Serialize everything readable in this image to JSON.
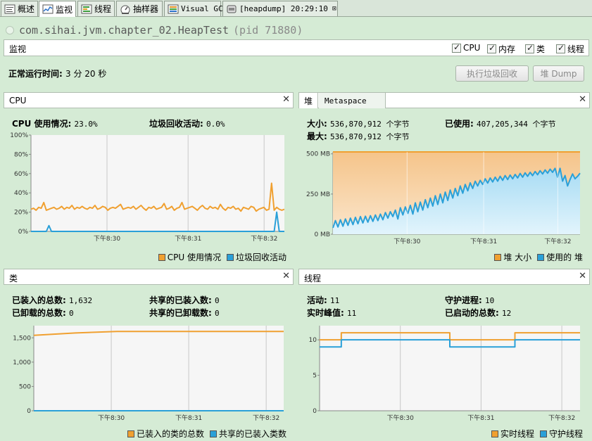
{
  "tabs": [
    {
      "label": "概述",
      "icon": "overview-icon"
    },
    {
      "label": "监视",
      "icon": "monitor-icon"
    },
    {
      "label": "线程",
      "icon": "threads-icon"
    },
    {
      "label": "抽样器",
      "icon": "sampler-icon"
    },
    {
      "label": "Visual GC",
      "icon": "visual-gc-icon"
    },
    {
      "label": "[heapdump] 20:29:10",
      "icon": "heapdump-icon"
    }
  ],
  "header": {
    "title": "com.sihai.jvm.chapter_02.HeapTest",
    "pid": "(pid 71880)"
  },
  "section": {
    "title": "监视",
    "checks": [
      {
        "label": "CPU",
        "checked": true
      },
      {
        "label": "内存",
        "checked": true
      },
      {
        "label": "类",
        "checked": true
      },
      {
        "label": "线程",
        "checked": true
      }
    ]
  },
  "uptime": {
    "label": "正常运行时间:",
    "value": "3 分 20 秒"
  },
  "buttons": {
    "gc": "执行垃圾回收",
    "heap_dump": "堆 Dump"
  },
  "colors": {
    "orange": "#f0a030",
    "blue": "#2aa0d8"
  },
  "cpu": {
    "title": "CPU",
    "usage_label": "CPU 使用情况:",
    "usage_value": "23.0%",
    "gc_label": "垃圾回收活动:",
    "gc_value": "0.0%",
    "legend": [
      "CPU 使用情况",
      "垃圾回收活动"
    ]
  },
  "heap": {
    "tab_heap": "堆",
    "tab_meta": "Metaspace",
    "size_label": "大小:",
    "size_value": "536,870,912 个字节",
    "max_label": "最大:",
    "max_value": "536,870,912 个字节",
    "used_label": "已使用:",
    "used_value": "407,205,344 个字节",
    "legend": [
      "堆 大小",
      "使用的 堆"
    ]
  },
  "classes": {
    "title": "类",
    "loaded_label": "已装入的总数:",
    "loaded_value": "1,632",
    "unloaded_label": "已卸载的总数:",
    "unloaded_value": "0",
    "shared_loaded_label": "共享的已装入数:",
    "shared_loaded_value": "0",
    "shared_unloaded_label": "共享的已卸载数:",
    "shared_unloaded_value": "0",
    "legend": [
      "已装入的类的总数",
      "共享的已装入类数"
    ]
  },
  "threads": {
    "title": "线程",
    "live_label": "活动:",
    "live_value": "11",
    "peak_label": "实时峰值:",
    "peak_value": "11",
    "daemon_label": "守护进程:",
    "daemon_value": "10",
    "started_label": "已启动的总数:",
    "started_value": "12",
    "legend": [
      "实时线程",
      "守护线程"
    ]
  },
  "chart_data": [
    {
      "type": "line",
      "x_ticks": [
        "下午8:30",
        "下午8:31",
        "下午8:32"
      ],
      "y_ticks": [
        "0%",
        "20%",
        "40%",
        "60%",
        "80%",
        "100%"
      ],
      "ylim": [
        0,
        100
      ],
      "series": [
        {
          "name": "CPU 使用情况",
          "color": "#f0a030",
          "values": [
            23,
            24,
            22,
            25,
            24,
            30,
            22,
            23,
            24,
            25,
            23,
            24,
            26,
            23,
            25,
            24,
            27,
            23,
            25,
            24,
            26,
            24,
            23,
            25,
            24,
            27,
            23,
            24,
            26,
            25,
            22,
            24,
            25,
            24,
            26,
            28,
            23,
            24,
            25,
            24,
            26,
            23,
            25,
            27,
            24,
            22,
            25,
            24,
            26,
            23,
            24,
            25,
            29,
            23,
            24,
            26,
            22,
            24,
            25,
            30,
            23,
            24,
            25,
            26,
            24,
            22,
            25,
            27,
            24,
            23,
            26,
            24,
            25,
            23,
            28,
            24,
            22,
            25,
            24,
            26,
            23,
            24,
            21,
            25,
            24,
            23,
            26,
            25,
            21,
            23,
            24,
            25,
            22,
            23,
            50,
            22,
            25,
            23,
            22,
            23
          ]
        },
        {
          "name": "垃圾回收活动",
          "color": "#2aa0d8",
          "values": [
            0,
            0,
            0,
            0,
            0,
            0,
            0,
            6,
            0,
            0,
            0,
            0,
            0,
            0,
            0,
            0,
            0,
            0,
            0,
            0,
            0,
            0,
            0,
            0,
            0,
            0,
            0,
            0,
            0,
            0,
            0,
            0,
            0,
            0,
            0,
            0,
            0,
            0,
            0,
            0,
            0,
            0,
            0,
            0,
            0,
            0,
            0,
            0,
            0,
            0,
            0,
            0,
            0,
            0,
            0,
            0,
            0,
            0,
            0,
            0,
            0,
            0,
            0,
            0,
            0,
            0,
            0,
            0,
            0,
            0,
            0,
            0,
            0,
            0,
            0,
            0,
            0,
            0,
            0,
            0,
            0,
            0,
            0,
            0,
            0,
            0,
            0,
            0,
            0,
            0,
            0,
            0,
            0,
            0,
            0,
            0,
            20,
            0,
            0,
            0
          ]
        }
      ]
    },
    {
      "type": "area",
      "x_ticks": [
        "下午8:30",
        "下午8:31",
        "下午8:32"
      ],
      "y_ticks": [
        "0 MB",
        "250 MB",
        "500 MB"
      ],
      "ylim": [
        0,
        512
      ],
      "series": [
        {
          "name": "堆 大小",
          "color": "#f0a030",
          "values": [
            512,
            512
          ]
        },
        {
          "name": "使用的 堆",
          "color": "#2aa0d8",
          "values": [
            40,
            85,
            45,
            90,
            50,
            95,
            55,
            100,
            60,
            105,
            65,
            110,
            70,
            112,
            75,
            115,
            80,
            120,
            85,
            125,
            90,
            135,
            100,
            140,
            110,
            150,
            95,
            165,
            120,
            170,
            130,
            180,
            125,
            195,
            140,
            200,
            150,
            215,
            165,
            225,
            175,
            240,
            185,
            250,
            195,
            262,
            210,
            275,
            225,
            285,
            240,
            300,
            255,
            310,
            270,
            320,
            285,
            330,
            300,
            335,
            310,
            345,
            318,
            350,
            325,
            355,
            330,
            360,
            335,
            365,
            340,
            368,
            345,
            372,
            350,
            378,
            355,
            382,
            360,
            385,
            365,
            390,
            370,
            395,
            375,
            400,
            380,
            405,
            385,
            410,
            355,
            410,
            330,
            365,
            300,
            340,
            375,
            345,
            360,
            380
          ]
        }
      ]
    },
    {
      "type": "line",
      "x_ticks": [
        "下午8:30",
        "下午8:31",
        "下午8:32"
      ],
      "y_ticks": [
        "0",
        "500",
        "1,000",
        "1,500"
      ],
      "ylim": [
        0,
        1750
      ],
      "series": [
        {
          "name": "已装入的类的总数",
          "color": "#f0a030",
          "values": [
            1550,
            1600,
            1632,
            1632,
            1632,
            1632,
            1632
          ]
        },
        {
          "name": "共享的已装入类数",
          "color": "#2aa0d8",
          "values": [
            0,
            0,
            0,
            0,
            0,
            0,
            0
          ]
        }
      ]
    },
    {
      "type": "line",
      "x_ticks": [
        "下午8:30",
        "下午8:31",
        "下午8:32"
      ],
      "y_ticks": [
        "0",
        "5",
        "10"
      ],
      "ylim": [
        0,
        12
      ],
      "series": [
        {
          "name": "实时线程",
          "color": "#f0a030",
          "values": [
            10,
            11,
            11,
            11,
            11,
            11,
            10,
            10,
            10,
            11,
            11,
            11,
            11
          ]
        },
        {
          "name": "守护线程",
          "color": "#2aa0d8",
          "values": [
            9,
            10,
            10,
            10,
            10,
            10,
            9,
            9,
            9,
            10,
            10,
            10,
            10
          ]
        }
      ]
    }
  ]
}
